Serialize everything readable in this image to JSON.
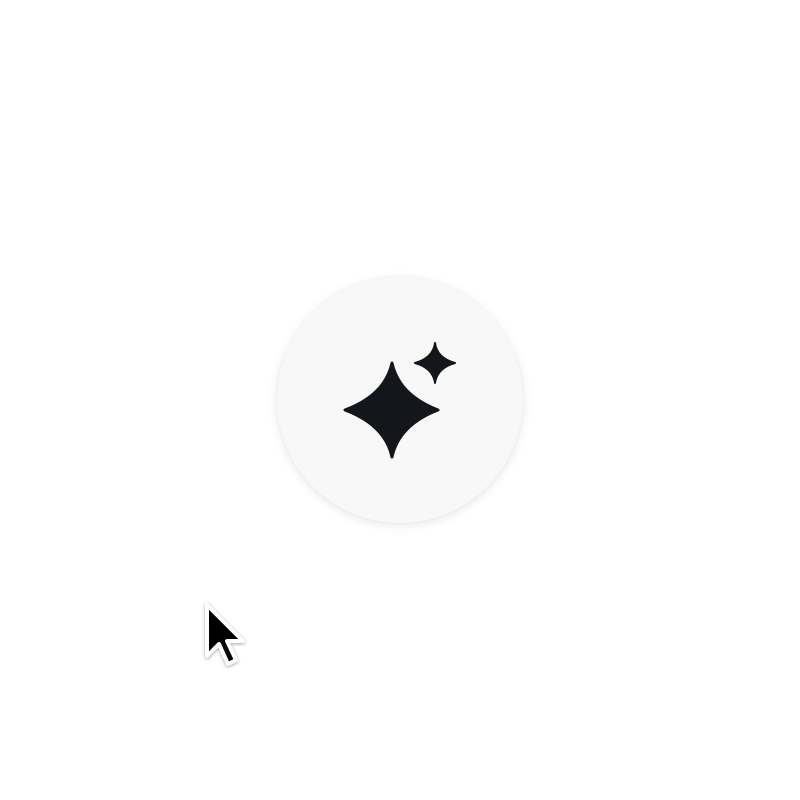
{
  "button": {
    "icon": "sparkles-icon",
    "background": "#f8f8f8",
    "icon_color": "#13171c"
  },
  "cursor": {
    "icon": "pointer-arrow-icon"
  }
}
